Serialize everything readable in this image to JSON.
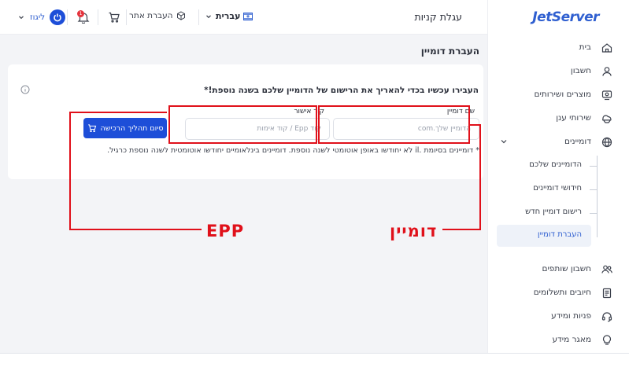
{
  "sidebar": {
    "logo": "JetServer",
    "items": [
      {
        "label": "בית",
        "icon": "home-icon"
      },
      {
        "label": "חשבון",
        "icon": "user-icon"
      },
      {
        "label": "מוצרים ושירותים",
        "icon": "box-icon"
      },
      {
        "label": "שירותי ענן",
        "icon": "cloud-icon"
      },
      {
        "label": "דומיינים",
        "icon": "globe-icon",
        "expanded": true
      }
    ],
    "domain_sub_items": [
      {
        "label": "הדומיינים שלכם",
        "active": false
      },
      {
        "label": "חידושי דומיינים",
        "active": false
      },
      {
        "label": "רישום דומיין חדש",
        "active": false
      },
      {
        "label": "העברת דומיין",
        "active": true
      }
    ],
    "bottom_items": [
      {
        "label": "חשבון שותפים",
        "icon": "partners-icon"
      },
      {
        "label": "חיובים ותשלומים",
        "icon": "invoice-icon"
      },
      {
        "label": "פניות ומידע",
        "icon": "headset-icon"
      },
      {
        "label": "מאגר מידע",
        "icon": "bulb-icon"
      }
    ]
  },
  "topbar": {
    "title": "עגלת קניות",
    "language": "עברית",
    "transfer_link": "העברת אתר",
    "notification_count": "1",
    "user_label": "ליגוז"
  },
  "main": {
    "title": "העברת דומיין",
    "card": {
      "heading": "העבירו עכשיו בכדי להאריך את הרישום של הדומיין שלכם בשנה נוספת!*",
      "domain_field": {
        "label": "שם דומיין",
        "placeholder": "הדומיין שלך.com",
        "value": ""
      },
      "epp_field": {
        "label": "קוד אישור",
        "placeholder": "קוד Epp / קוד אימות",
        "value": ""
      },
      "submit_label": "סיום תהליך הרכישה",
      "note": "* דומיינים בסיומת .il לא יחודשו באופן אוטומטי לשנה נוספת. דומיינים בינלאומיים יחודשו אוטומטית לשנה נוספת כרגיל."
    }
  },
  "annotations": {
    "domain_label": "דומיין",
    "epp_label": "EPP",
    "color": "#e0101a"
  },
  "colors": {
    "accent": "#1d4ed8",
    "brand": "#2f5fd0",
    "background": "#f3f4f7"
  }
}
